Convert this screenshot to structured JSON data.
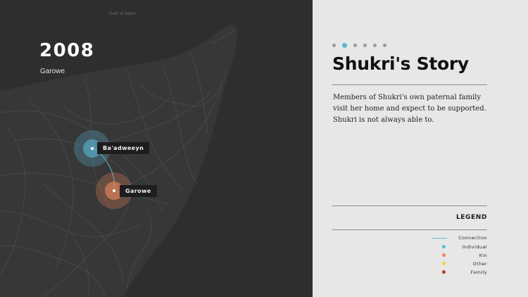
{
  "map": {
    "sea_label": "Gulf of Aden",
    "year": "2008",
    "place": "Garowe",
    "pins": [
      {
        "label": "Ba'adweeyn",
        "kind": "Individual"
      },
      {
        "label": "Garowe",
        "kind": "Kin"
      }
    ]
  },
  "story": {
    "pagination": {
      "total": 6,
      "active_index": 1
    },
    "title": "Shukri's Story",
    "body": "Members of Shukri's own paternal family visit her home and expect to be supported. Shukri is not always able to."
  },
  "legend": {
    "title": "LEGEND",
    "items": [
      {
        "label": "Connection",
        "swatch": "line",
        "color": "#5bb8d6"
      },
      {
        "label": "Individual",
        "swatch": "dot",
        "color": "#5bb8d6"
      },
      {
        "label": "Kin",
        "swatch": "dot",
        "color": "#f08a5d"
      },
      {
        "label": "Other",
        "swatch": "dot",
        "color": "#f2d43a"
      },
      {
        "label": "Family",
        "swatch": "dot",
        "color": "#b8392b"
      }
    ]
  },
  "colors": {
    "map_bg": "#2e2e2e",
    "land": "#3a3a3a",
    "roads": "#555555",
    "individual": "#5bb8d6",
    "kin": "#f08a5d",
    "panel_bg": "#e7e7e7"
  }
}
